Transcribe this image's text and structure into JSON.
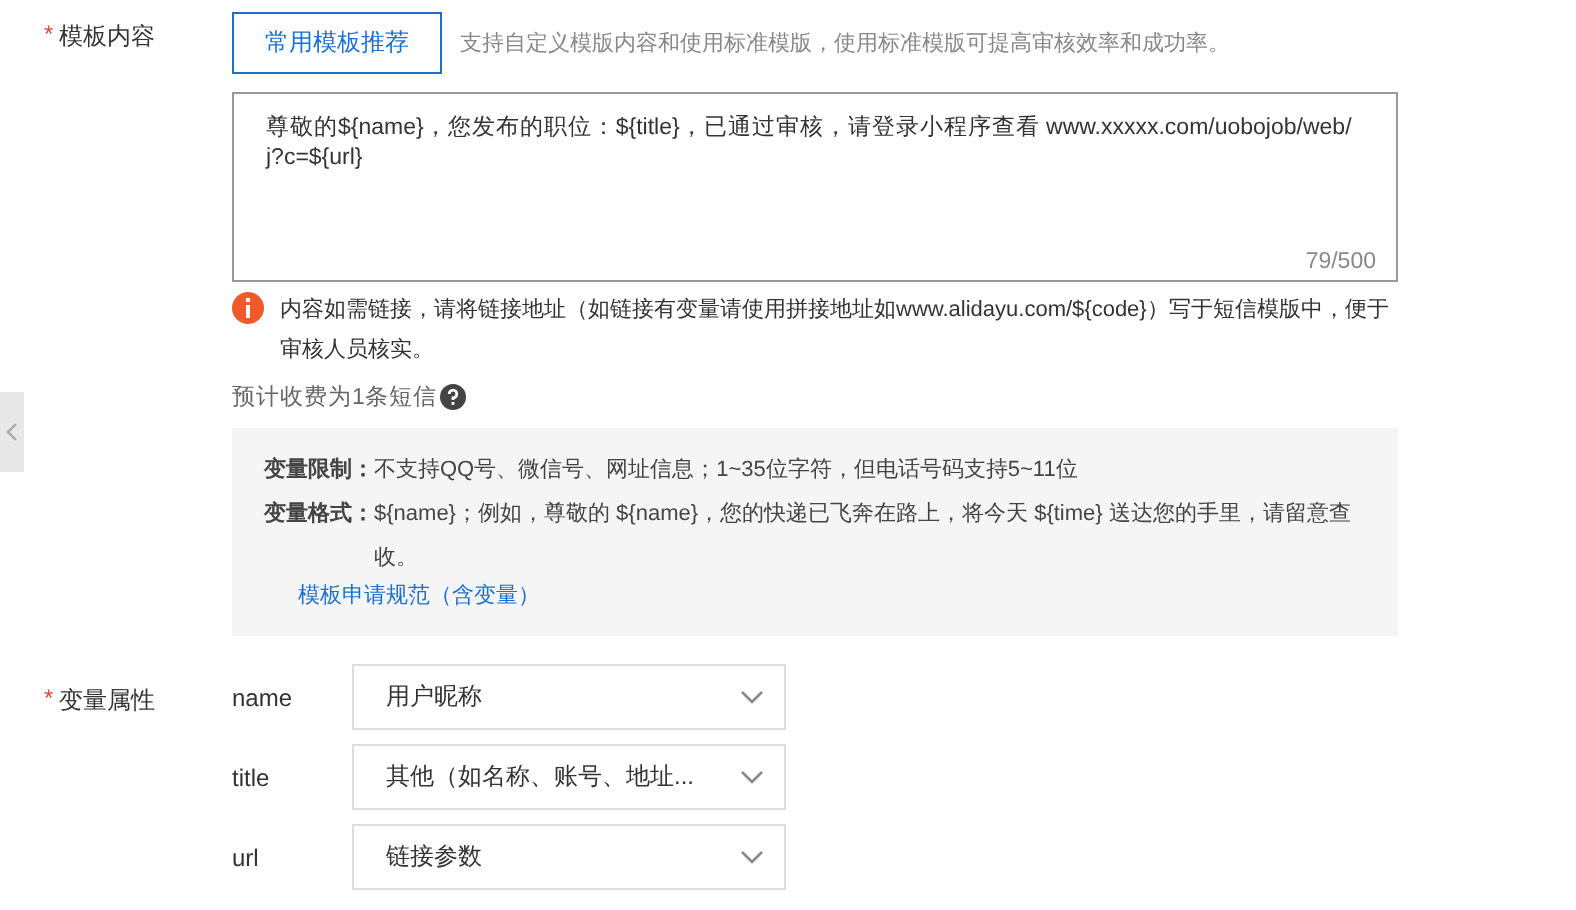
{
  "template_field": {
    "required_mark": "*",
    "label": "模板内容",
    "recommend_button": "常用模板推荐",
    "hint": "支持自定义模版内容和使用标准模版，使用标准模版可提高审核效率和成功率。",
    "content": "尊敬的${name}，您发布的职位：${title}，已通过审核，请登录小程序查看 www.xxxxx.com/uobojob/web/j?c=${url}",
    "counter": "79/500",
    "warning": "内容如需链接，请将链接地址（如链接有变量请使用拼接地址如www.alidayu.com/${code}）写于短信模版中，便于审核人员核实。",
    "estimate": "预计收费为1条短信",
    "rules": [
      {
        "label": "变量限制：",
        "text": "不支持QQ号、微信号、网址信息；1~35位字符，但电话号码支持5~11位"
      },
      {
        "label": "变量格式：",
        "text": "${name}；例如，尊敬的 ${name}，您的快递已飞奔在路上，将今天 ${time} 送达您的手里，请留意查收。"
      }
    ],
    "rules_link": "模板申请规范（含变量）"
  },
  "variables_field": {
    "required_mark": "*",
    "label": "变量属性",
    "variables": [
      {
        "name": "name",
        "value": "用户昵称"
      },
      {
        "name": "title",
        "value": "其他（如名称、账号、地址..."
      },
      {
        "name": "url",
        "value": "链接参数"
      }
    ]
  }
}
